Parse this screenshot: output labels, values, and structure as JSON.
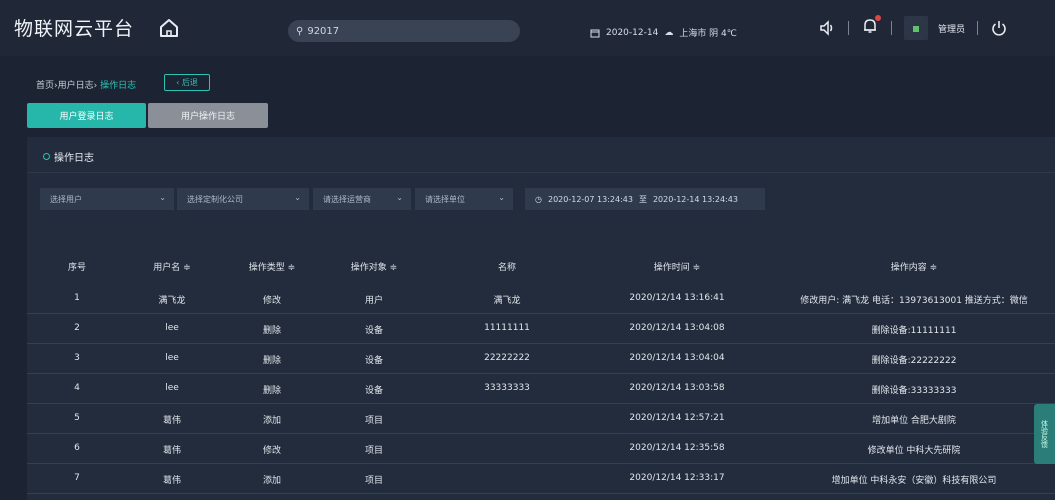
{
  "header": {
    "app_title": "物联网云平台",
    "search_value": "92017",
    "date": "2020-12-14",
    "weather": "上海市 阴 4℃",
    "admin_name": "管理员"
  },
  "breadcrumb": {
    "home": "首页",
    "sep1": "›",
    "parent": "用户日志",
    "sep2": "›",
    "current": "操作日志"
  },
  "back_button": "‹ 后退",
  "tabs": [
    {
      "label": "用户登录日志"
    },
    {
      "label": "用户操作日志"
    }
  ],
  "panel": {
    "title": "操作日志",
    "filters": {
      "user": "选择用户",
      "company": "选择定制化公司",
      "operator": "请选择运营商",
      "unit": "请选择单位",
      "date_start": "2020-12-07 13:24:43",
      "date_sep": "至",
      "date_end": "2020-12-14 13:24:43"
    }
  },
  "table": {
    "headers": [
      "序号",
      "用户名 ≑",
      "操作类型 ≑",
      "操作对象 ≑",
      "名称",
      "操作时间 ≑",
      "操作内容 ≑"
    ],
    "rows": [
      [
        "1",
        "满飞龙",
        "修改",
        "用户",
        "满飞龙",
        "2020/12/14 13:16:41",
        "修改用户: 满飞龙 电话：13973613001 推送方式：微信"
      ],
      [
        "2",
        "lee",
        "删除",
        "设备",
        "11111111",
        "2020/12/14 13:04:08",
        "删除设备:11111111"
      ],
      [
        "3",
        "lee",
        "删除",
        "设备",
        "22222222",
        "2020/12/14 13:04:04",
        "删除设备:22222222"
      ],
      [
        "4",
        "lee",
        "删除",
        "设备",
        "33333333",
        "2020/12/14 13:03:58",
        "删除设备:33333333"
      ],
      [
        "5",
        "葛伟",
        "添加",
        "项目",
        "",
        "2020/12/14 12:57:21",
        "增加单位 合肥大剧院"
      ],
      [
        "6",
        "葛伟",
        "修改",
        "项目",
        "",
        "2020/12/14 12:35:58",
        "修改单位 中科大先研院"
      ],
      [
        "7",
        "葛伟",
        "添加",
        "项目",
        "",
        "2020/12/14 12:33:17",
        "增加单位 中科永安（安徽）科技有限公司"
      ]
    ]
  },
  "side_float": "体验反馈",
  "colors": {
    "accent": "#2ec2b5",
    "background": "#1c2433",
    "panel": "#232c3c"
  }
}
